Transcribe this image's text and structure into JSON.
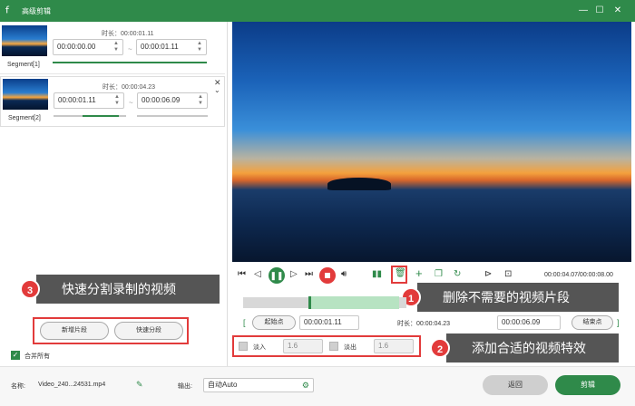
{
  "window": {
    "title": "高级剪辑",
    "logo_glyph": "ꬵ",
    "min_glyph": "—",
    "max_glyph": "☐",
    "close_glyph": "✕"
  },
  "segments": [
    {
      "label": "Segment[1]",
      "duration": "时长：00:00:01.11",
      "start": "00:00:00.00",
      "end": "00:00:01.11"
    },
    {
      "label": "Segment[2]",
      "duration": "时长：00:00:04.23",
      "start": "00:00:01.11",
      "end": "00:00:06.09"
    }
  ],
  "left_actions": {
    "new_segment": "新增片段",
    "quick_split": "快速分段",
    "merge_all": "合并所有"
  },
  "callouts": [
    {
      "n": "1",
      "text": "删除不需要的视频片段"
    },
    {
      "n": "2",
      "text": "添加合适的视频特效"
    },
    {
      "n": "3",
      "text": "快速分割录制的视频"
    }
  ],
  "player": {
    "time": "00:00:04.07/00:00:08.00"
  },
  "trim": {
    "start_label": "起始点",
    "start": "00:00:01.11",
    "duration_label": "时长：00:00:04.23",
    "end": "00:00:06.09",
    "end_label": "结束点"
  },
  "fade": {
    "fade_in_label": "淡入",
    "fade_in": "1.6",
    "fade_out_label": "淡出",
    "fade_out": "1.6"
  },
  "footer": {
    "name_label": "名称:",
    "name_value": "Video_240...24531.mp4",
    "output_label": "输出:",
    "output_value": "自动Auto",
    "back_button": "返回",
    "cut_button": "剪辑"
  },
  "colors": {
    "brand": "#2f8a4a",
    "callout_bg": "#555555",
    "badge": "#e23b3b"
  }
}
